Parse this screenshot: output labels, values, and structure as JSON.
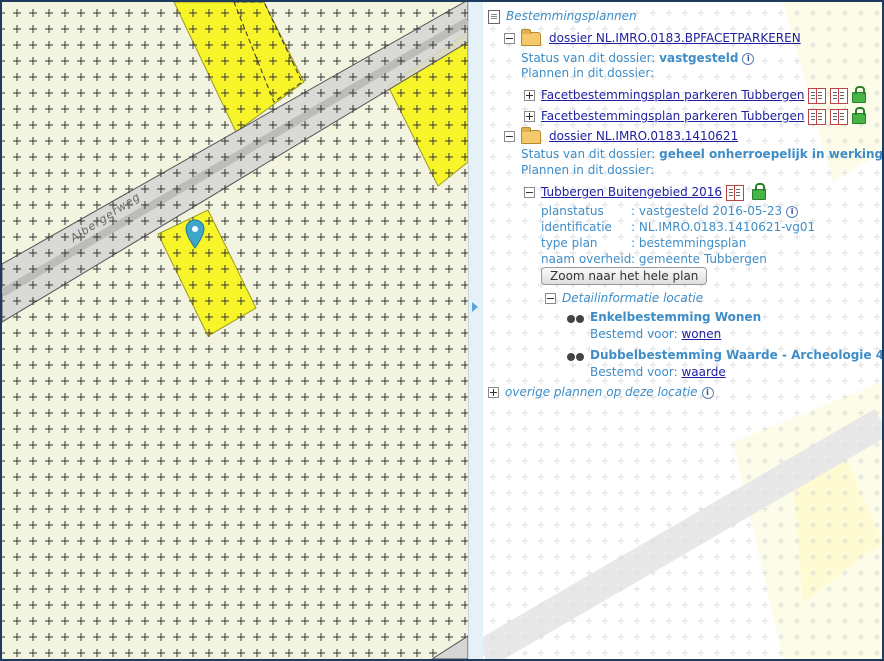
{
  "map": {
    "street_label": "Albergerweg",
    "colors": {
      "background": "#f3f4e0",
      "parcel": "#f7f42a",
      "road": "#d6d6d4",
      "marker": "#3ea7c9",
      "crosses": "#333333"
    }
  },
  "panel": {
    "root_title": "Bestemmingsplannen",
    "dossiers": [
      {
        "name": "dossier NL.IMRO.0183.BPFACETPARKEREN",
        "status_label": "Status van dit dossier:",
        "status_value": "vastgesteld",
        "plans_label": "Plannen in dit dossier:",
        "plans": [
          {
            "name": "Facetbestemmingsplan parkeren Tubbergen"
          },
          {
            "name": "Facetbestemmingsplan parkeren Tubbergen"
          }
        ]
      },
      {
        "name": "dossier NL.IMRO.0183.1410621",
        "status_label": "Status van dit dossier:",
        "status_value": "geheel onherroepelijk in werking",
        "plans_label": "Plannen in dit dossier:",
        "plan": {
          "name": "Tubbergen Buitengebied 2016",
          "properties": [
            {
              "key": "planstatus",
              "value": ": vastgesteld 2016-05-23"
            },
            {
              "key": "identificatie",
              "value": ": NL.IMRO.0183.1410621-vg01"
            },
            {
              "key": "type plan",
              "value": ": bestemmingsplan"
            },
            {
              "key": "naam overheid",
              "value": ": gemeente Tubbergen"
            }
          ],
          "zoom_button": "Zoom naar het hele plan",
          "detail_title": "Detailinformatie locatie",
          "details": [
            {
              "title": "Enkelbestemming Wonen",
              "label": "Bestemd voor:",
              "link": "wonen"
            },
            {
              "title": "Dubbelbestemming Waarde - Archeologie 4",
              "label": "Bestemd voor:",
              "link": "waarde"
            }
          ]
        }
      }
    ],
    "other_plans": "overige plannen op deze locatie",
    "info_glyph": "i"
  }
}
